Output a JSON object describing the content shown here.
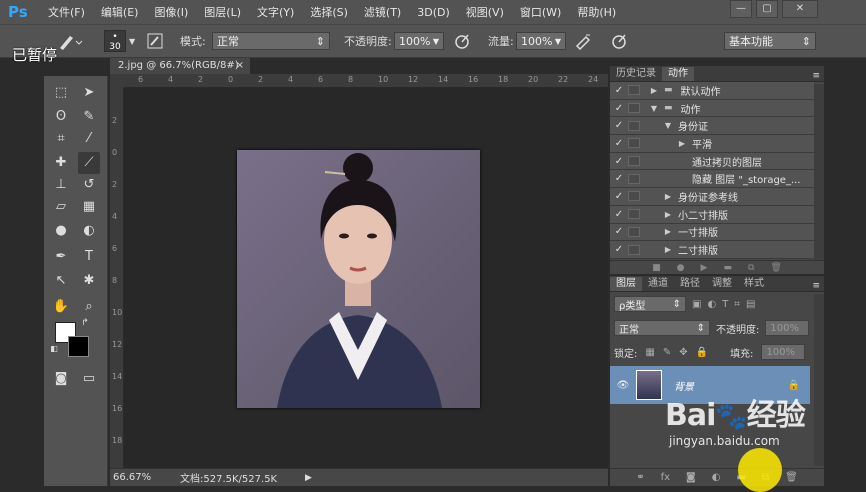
{
  "app": {
    "logo": "Ps"
  },
  "menu": [
    "文件(F)",
    "编辑(E)",
    "图像(I)",
    "图层(L)",
    "文字(Y)",
    "选择(S)",
    "滤镜(T)",
    "3D(D)",
    "视图(V)",
    "窗口(W)",
    "帮助(H)"
  ],
  "window_controls": {
    "minimize": "—",
    "restore": "▢",
    "close": "✕"
  },
  "overlay": {
    "paused": "已暂停"
  },
  "options": {
    "brush_size": "30",
    "mode_label": "模式:",
    "mode_value": "正常",
    "opacity_label": "不透明度:",
    "opacity_value": "100%",
    "flow_label": "流量:",
    "flow_value": "100%",
    "workspace": "基本功能"
  },
  "document": {
    "tab_title": "2.jpg @ 66.7%(RGB/8#)",
    "tab_close": "×",
    "ruler_h": [
      "6",
      "4",
      "2",
      "0",
      "2",
      "4",
      "6",
      "8",
      "10",
      "12",
      "14",
      "16",
      "18",
      "20",
      "22",
      "24"
    ],
    "ruler_v": [
      "2",
      "0",
      "2",
      "4",
      "6",
      "8",
      "10",
      "12",
      "14",
      "16",
      "18",
      "20"
    ],
    "zoom": "66.67%",
    "doc_info": "文档:527.5K/527.5K"
  },
  "actions_panel": {
    "tabs": [
      "历史记录",
      "动作"
    ],
    "active_tab": 1,
    "rows": [
      {
        "label": "默认动作",
        "indent": 0,
        "tri": "▶",
        "folder": true
      },
      {
        "label": "动作",
        "indent": 0,
        "tri": "▼",
        "folder": true
      },
      {
        "label": "身份证",
        "indent": 1,
        "tri": "▼",
        "folder": false
      },
      {
        "label": "平滑",
        "indent": 2,
        "tri": "▶",
        "folder": false
      },
      {
        "label": "通过拷贝的图层",
        "indent": 2,
        "tri": "",
        "folder": false
      },
      {
        "label": "隐藏 图层 \"_storage_...",
        "indent": 2,
        "tri": "",
        "folder": false
      },
      {
        "label": "身份证参考线",
        "indent": 1,
        "tri": "▶",
        "folder": false
      },
      {
        "label": "小二寸排版",
        "indent": 1,
        "tri": "▶",
        "folder": false
      },
      {
        "label": "一寸排版",
        "indent": 1,
        "tri": "▶",
        "folder": false
      },
      {
        "label": "二寸排版",
        "indent": 1,
        "tri": "▶",
        "folder": false
      }
    ]
  },
  "layers_panel": {
    "tabs": [
      "图层",
      "通道",
      "路径",
      "调整",
      "样式"
    ],
    "active_tab": 0,
    "filter_kind": "ρ类型",
    "blend_mode": "正常",
    "opacity_label": "不透明度:",
    "opacity_value": "100%",
    "lock_label": "锁定:",
    "fill_label": "填充:",
    "fill_value": "100%",
    "layer_name": "背景"
  },
  "watermark": {
    "brand": "Bai",
    "brand2": "经验",
    "url": "jingyan.baidu.com"
  }
}
